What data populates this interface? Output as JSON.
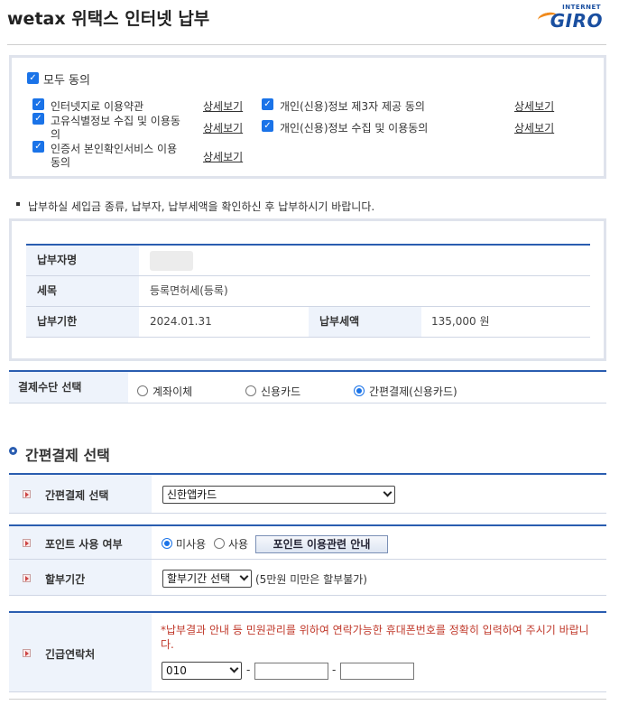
{
  "header": {
    "title": "wetax 위택스 인터넷 납부",
    "logo_small": "INTERNET",
    "logo_big": "GIRO"
  },
  "agree": {
    "all_label": "모두 동의",
    "items": [
      {
        "label_l1": "인터넷지로 이용약관",
        "label_l2": "",
        "link": "상세보기"
      },
      {
        "label_l1": "고유식별정보 수집 및 이용동",
        "label_l2": "의",
        "link": "상세보기"
      },
      {
        "label_l1": "인증서 본인확인서비스 이용",
        "label_l2": "동의",
        "link": "상세보기"
      },
      {
        "label_l1": "개인(신용)정보 제3자 제공 동의",
        "label_l2": "",
        "link": "상세보기"
      },
      {
        "label_l1": "개인(신용)정보 수집 및 이용동의",
        "label_l2": "",
        "link": "상세보기"
      }
    ]
  },
  "notice": "납부하실 세입금 종류, 납부자, 납부세액을 확인하신 후 납부하시기 바랍니다.",
  "info": {
    "payer_label": "납부자명",
    "tax_label": "세목",
    "tax_value": "등록면허세(등록)",
    "due_label": "납부기한",
    "due_value": "2024.01.31",
    "amount_label": "납부세액",
    "amount_value": "135,000 원"
  },
  "payment": {
    "label": "결제수단 선택",
    "options": [
      "계좌이체",
      "신용카드",
      "간편결제(신용카드)"
    ],
    "selected": "간편결제(신용카드)"
  },
  "section_title": "간편결제 선택",
  "easypay": {
    "label": "간편결제 선택",
    "selected": "신한앱카드"
  },
  "points": {
    "label": "포인트 사용 여부",
    "opt_no": "미사용",
    "opt_yes": "사용",
    "guide_button": "포인트 이용관련 안내"
  },
  "installment": {
    "label": "할부기간",
    "selected": "할부기간 선택",
    "note": "(5만원 미만은 할부불가)"
  },
  "contact": {
    "label": "긴급연락처",
    "notice": "*납부결과 안내 등 민원관리를 위하여 연락가능한 휴대폰번호를 정확히 입력하여 주시기 바랍니다.",
    "prefix": "010",
    "dash": "-"
  },
  "colors": {
    "accent": "#2a5db0",
    "checkbox": "#1a73e8",
    "warning": "#c0392b"
  }
}
